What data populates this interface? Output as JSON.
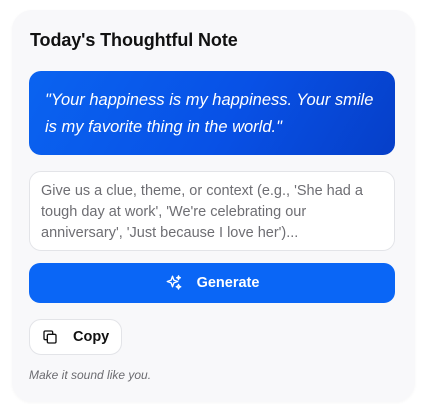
{
  "card": {
    "title": "Today's Thoughtful Note",
    "quote": "\"Your happiness is my happiness. Your smile is my favorite thing in the world.\"",
    "context_placeholder": "Give us a clue, theme, or context (e.g., 'She had a tough day at work', 'We're celebrating our anniversary', 'Just because I love her')...",
    "context_value": "",
    "generate_label": "Generate",
    "copy_label": "Copy",
    "hint": "Make it sound like you."
  },
  "icons": {
    "generate": "sparkles-icon",
    "copy": "copy-icon"
  },
  "colors": {
    "accent": "#0a66f6",
    "quote_gradient_start": "#0a63f0",
    "quote_gradient_end": "#063fc8",
    "card_background": "#f8f8fa"
  }
}
